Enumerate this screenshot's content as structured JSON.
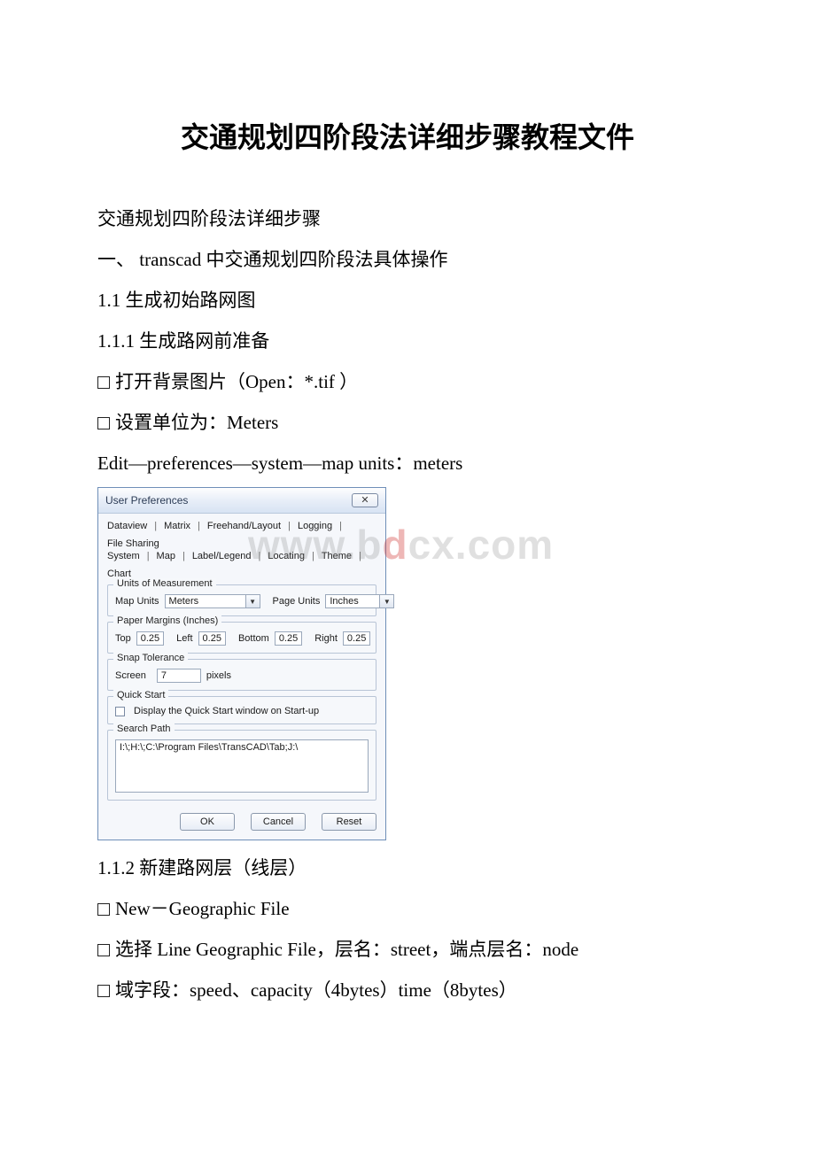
{
  "doc": {
    "title": "交通规划四阶段法详细步骤教程文件",
    "p1": "交通规划四阶段法详细步骤",
    "p2": "一、 transcad 中交通规划四阶段法具体操作",
    "p3": "1.1 生成初始路网图",
    "p4": "1.1.1 生成路网前准备",
    "p5": "打开背景图片（Open：*.tif ）",
    "p6": "设置单位为：Meters",
    "p7": "Edit—preferences—system—map units：meters",
    "p8": "1.1.2 新建路网层（线层）",
    "p9": "New－Geographic File",
    "p10": "选择 Line Geographic File，层名：street，端点层名：node",
    "p11": "域字段：speed、capacity（4bytes）time（8bytes）"
  },
  "watermark": {
    "left": "www.b",
    "mid": "d",
    "right": "cx.com"
  },
  "dialog": {
    "title": "User Preferences",
    "close": "✕",
    "tabs_row1": [
      "Dataview",
      "Matrix",
      "Freehand/Layout",
      "Logging",
      "File Sharing"
    ],
    "tabs_row2": [
      "System",
      "Map",
      "Label/Legend",
      "Locating",
      "Theme",
      "Chart"
    ],
    "units": {
      "legend": "Units of Measurement",
      "map_label": "Map Units",
      "map_value": "Meters",
      "page_label": "Page Units",
      "page_value": "Inches"
    },
    "margins": {
      "legend": "Paper Margins (Inches)",
      "top_label": "Top",
      "top_val": "0.25",
      "left_label": "Left",
      "left_val": "0.25",
      "bottom_label": "Bottom",
      "bottom_val": "0.25",
      "right_label": "Right",
      "right_val": "0.25"
    },
    "snap": {
      "legend": "Snap Tolerance",
      "screen_label": "Screen",
      "screen_val": "7",
      "screen_unit": "pixels"
    },
    "quick": {
      "legend": "Quick Start",
      "text": "Display the Quick Start window on Start-up"
    },
    "search": {
      "legend": "Search Path",
      "value": "I:\\;H:\\;C:\\Program Files\\TransCAD\\Tab;J:\\"
    },
    "buttons": {
      "ok": "OK",
      "cancel": "Cancel",
      "reset": "Reset"
    }
  }
}
